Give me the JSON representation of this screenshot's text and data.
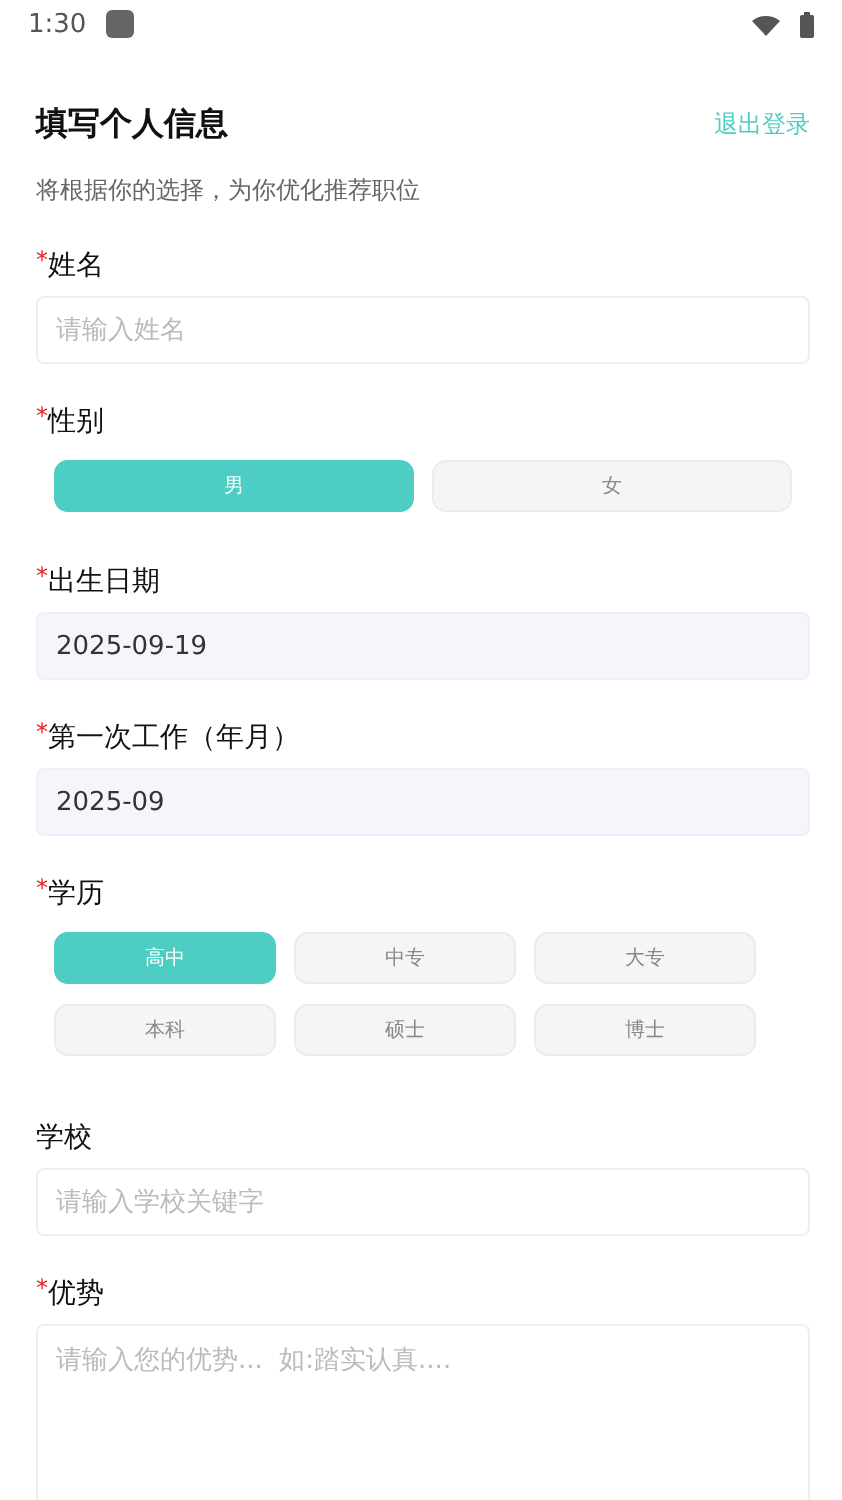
{
  "status_bar": {
    "time": "1:30"
  },
  "header": {
    "title": "填写个人信息",
    "logout": "退出登录",
    "subtitle": "将根据你的选择，为你优化推荐职位"
  },
  "fields": [
    {
      "kind": "input",
      "required_mark": "*",
      "label": "姓名",
      "placeholder": "请输入姓名"
    },
    {
      "kind": "choice",
      "required_mark": "*",
      "label": "性别",
      "options": [
        {
          "label": "男",
          "selected": true
        },
        {
          "label": "女",
          "selected": false
        }
      ]
    },
    {
      "kind": "select",
      "required_mark": "*",
      "label": "出生日期",
      "value": "2025-09-19"
    },
    {
      "kind": "select",
      "required_mark": "*",
      "label": "第一次工作（年月）",
      "value": "2025-09"
    },
    {
      "kind": "choice",
      "required_mark": "*",
      "label": "学历",
      "options": [
        {
          "label": "高中",
          "selected": true
        },
        {
          "label": "中专",
          "selected": false
        },
        {
          "label": "大专",
          "selected": false
        },
        {
          "label": "本科",
          "selected": false
        },
        {
          "label": "硕士",
          "selected": false
        },
        {
          "label": "博士",
          "selected": false
        }
      ]
    },
    {
      "kind": "input",
      "label": "学校",
      "placeholder": "请输入学校关键字"
    },
    {
      "kind": "textarea",
      "required_mark": "*",
      "label": "优势",
      "placeholder": "请输入您的优势...  如:踏实认真...."
    }
  ]
}
